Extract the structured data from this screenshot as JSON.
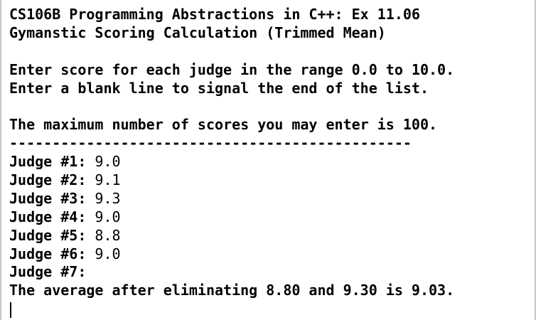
{
  "header": {
    "title": "CS106B Programming Abstractions in C++: Ex 11.06",
    "subtitle": "Gymanstic Scoring Calculation (Trimmed Mean)"
  },
  "instructions": {
    "line1": "Enter score for each judge in the range 0.0 to 10.0.",
    "line2": "Enter a blank line to signal the end of the list."
  },
  "max_note": "The maximum number of scores you may enter is 100.",
  "separator": "-----------------------------------------------",
  "judges": [
    {
      "label": "Judge #1: ",
      "score": "9.0"
    },
    {
      "label": "Judge #2: ",
      "score": "9.1"
    },
    {
      "label": "Judge #3: ",
      "score": "9.3"
    },
    {
      "label": "Judge #4: ",
      "score": "9.0"
    },
    {
      "label": "Judge #5: ",
      "score": "8.8"
    },
    {
      "label": "Judge #6: ",
      "score": "9.0"
    },
    {
      "label": "Judge #7:",
      "score": ""
    }
  ],
  "result": "The average after eliminating 8.80 and 9.30 is 9.03."
}
